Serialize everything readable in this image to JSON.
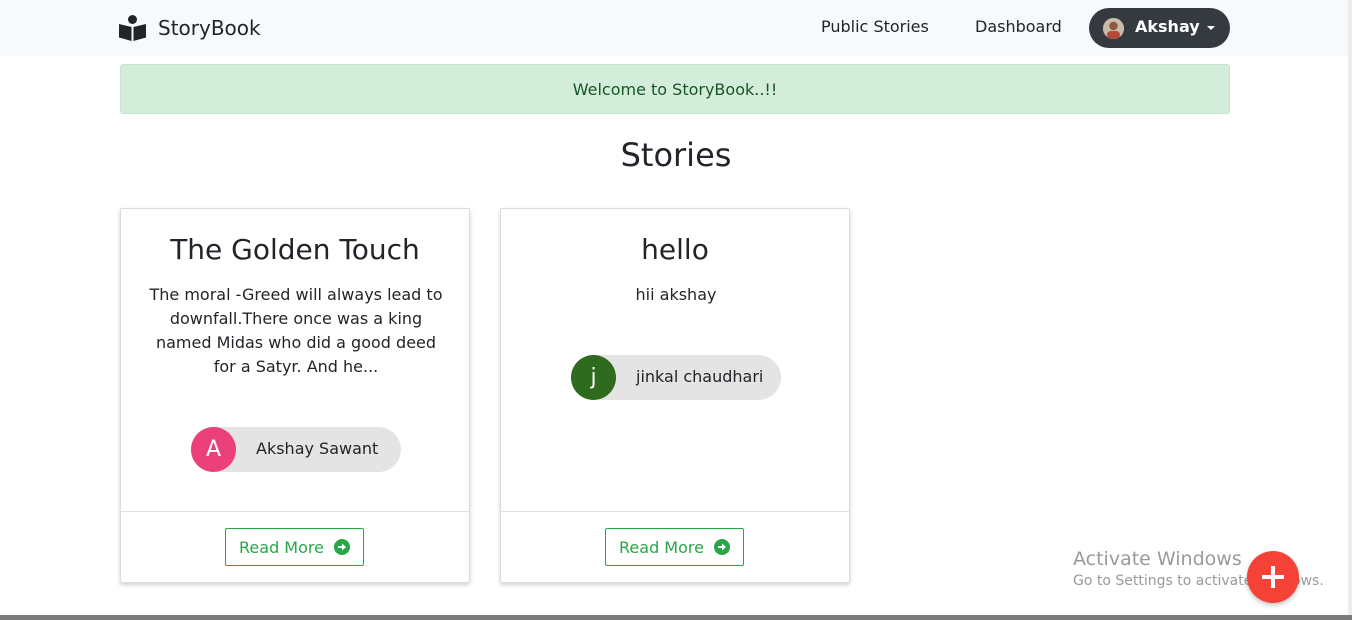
{
  "navbar": {
    "brand": "StoryBook",
    "links": [
      "Public Stories",
      "Dashboard"
    ],
    "user": {
      "name": "Akshay"
    }
  },
  "alert": {
    "message": "Welcome to StoryBook..!!"
  },
  "page": {
    "title": "Stories"
  },
  "stories": [
    {
      "title": "The Golden Touch",
      "excerpt": "The moral -Greed will always lead to downfall.There once was a king named Midas who did a good deed for a Satyr. And he...",
      "author": {
        "initial": "A",
        "name": "Akshay Sawant",
        "color": "#ec407a"
      },
      "button": "Read More"
    },
    {
      "title": "hello",
      "excerpt": "hii akshay",
      "author": {
        "initial": "j",
        "name": "jinkal chaudhari",
        "color": "#2e6b1e"
      },
      "button": "Read More"
    }
  ],
  "watermark": {
    "line1": "Activate Windows",
    "line2": "Go to Settings to activate Windows."
  },
  "colors": {
    "accent": "#28a745",
    "fab": "#f44336",
    "alert_bg": "#d4edda",
    "user_menu_bg": "#343a40"
  },
  "icons": [
    "book-reader-icon",
    "user-photo-icon",
    "caret-down-icon",
    "arrow-circle-right-icon",
    "plus-icon"
  ]
}
